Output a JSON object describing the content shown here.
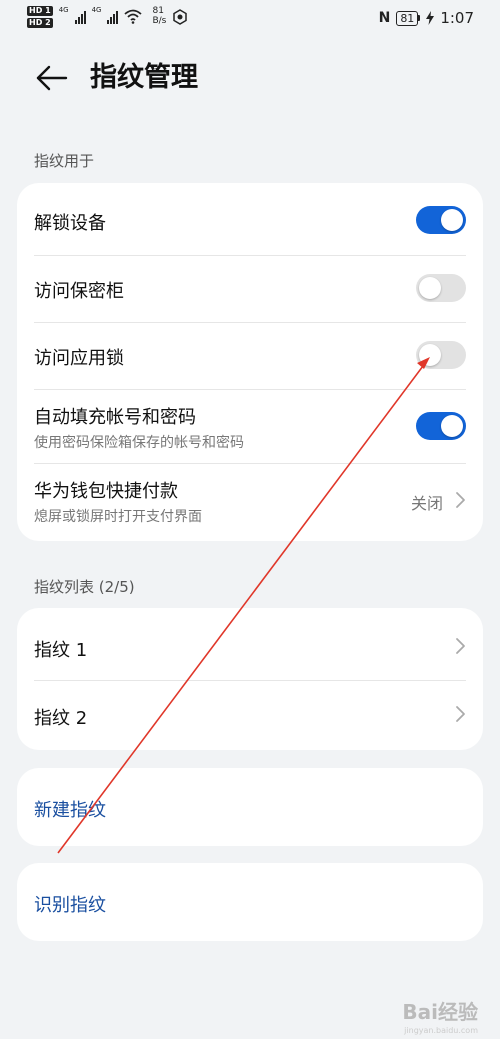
{
  "status_bar": {
    "sim1": "HD 1",
    "sim2": "HD 2",
    "network1": "4G",
    "network2": "4G",
    "speed_value": "81",
    "speed_unit": "B/s",
    "battery": "81",
    "time": "1:07",
    "icons": [
      "signal-icon",
      "wifi-icon",
      "hotspot-icon",
      "nfc-icon",
      "battery-icon",
      "charging-icon"
    ]
  },
  "header": {
    "title": "指纹管理",
    "back_icon": "back-arrow-icon"
  },
  "fingerprint_use": {
    "section_label": "指纹用于",
    "items": [
      {
        "title": "解锁设备",
        "toggle": true
      },
      {
        "title": "访问保密柜",
        "toggle": false
      },
      {
        "title": "访问应用锁",
        "toggle": false
      },
      {
        "title": "自动填充帐号和密码",
        "subtitle": "使用密码保险箱保存的帐号和密码",
        "toggle": true
      },
      {
        "title": "华为钱包快捷付款",
        "subtitle": "熄屏或锁屏时打开支付界面",
        "value": "关闭"
      }
    ]
  },
  "fingerprint_list": {
    "section_label": "指纹列表 (2/5)",
    "items": [
      {
        "title": "指纹 1"
      },
      {
        "title": "指纹 2"
      }
    ]
  },
  "actions": {
    "new_fingerprint": "新建指纹",
    "identify_fingerprint": "识别指纹"
  },
  "watermark": {
    "text": "Bai经验",
    "sub": "jingyan.baidu.com"
  },
  "colors": {
    "accent": "#1264d8",
    "link": "#1a4fa0",
    "background": "#f1f3f5",
    "annotation": "#e0372a"
  }
}
